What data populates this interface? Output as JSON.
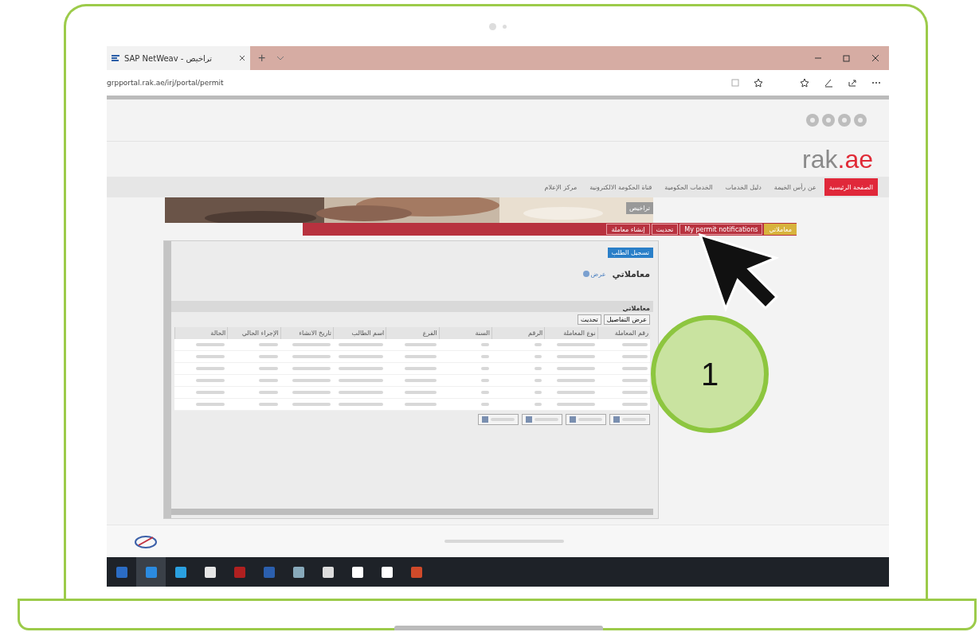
{
  "browser": {
    "tab_title": "SAP NetWeav - تراخيص",
    "new_tab": "+",
    "address": "grpportal.rak.ae/irj/portal/permit"
  },
  "site": {
    "logo_main": "rak",
    "logo_suffix": ".ae",
    "nav": [
      {
        "label": "الصفحة الرئيسية",
        "selected": true
      },
      {
        "label": "عن رأس الخيمة",
        "selected": false
      },
      {
        "label": "دليل الخدمات",
        "selected": false
      },
      {
        "label": "الخدمات الحكومية",
        "selected": false
      },
      {
        "label": "قناة الحكومة الالكترونية",
        "selected": false
      },
      {
        "label": "مركز الإعلام",
        "selected": false
      }
    ],
    "banner_title": "تراخيص",
    "subnav": [
      {
        "label": "معاملاتي",
        "selected": true
      },
      {
        "label": "My permit notifications",
        "selected": false
      },
      {
        "label": "تحديث",
        "selected": false
      },
      {
        "label": "إنشاء معاملة",
        "selected": false
      }
    ]
  },
  "panel": {
    "action_button": "تسجيل الطلب",
    "title": "معاملاتي",
    "help_link": "عرض",
    "section_title": "معاملاتي",
    "toolbar_buttons": [
      "عرض التفاصيل",
      "تحديث"
    ],
    "columns": [
      "رقم المعاملة",
      "نوع المعاملة",
      "الرقم",
      "السنة",
      "الفرع",
      "اسم الطالب",
      "تاريخ الانشاء",
      "الإجراء الحالي",
      "الحالة"
    ],
    "rows": [
      {
        "kind": "blurred"
      },
      {
        "kind": "blurred"
      },
      {
        "kind": "blurred"
      },
      {
        "kind": "blurred"
      },
      {
        "kind": "blurred"
      },
      {
        "kind": "blurred"
      }
    ],
    "footer_buttons": [
      {
        "kind": "blurred"
      },
      {
        "kind": "blurred"
      },
      {
        "kind": "blurred"
      },
      {
        "kind": "blurred"
      }
    ]
  },
  "callout": {
    "label": "1"
  }
}
